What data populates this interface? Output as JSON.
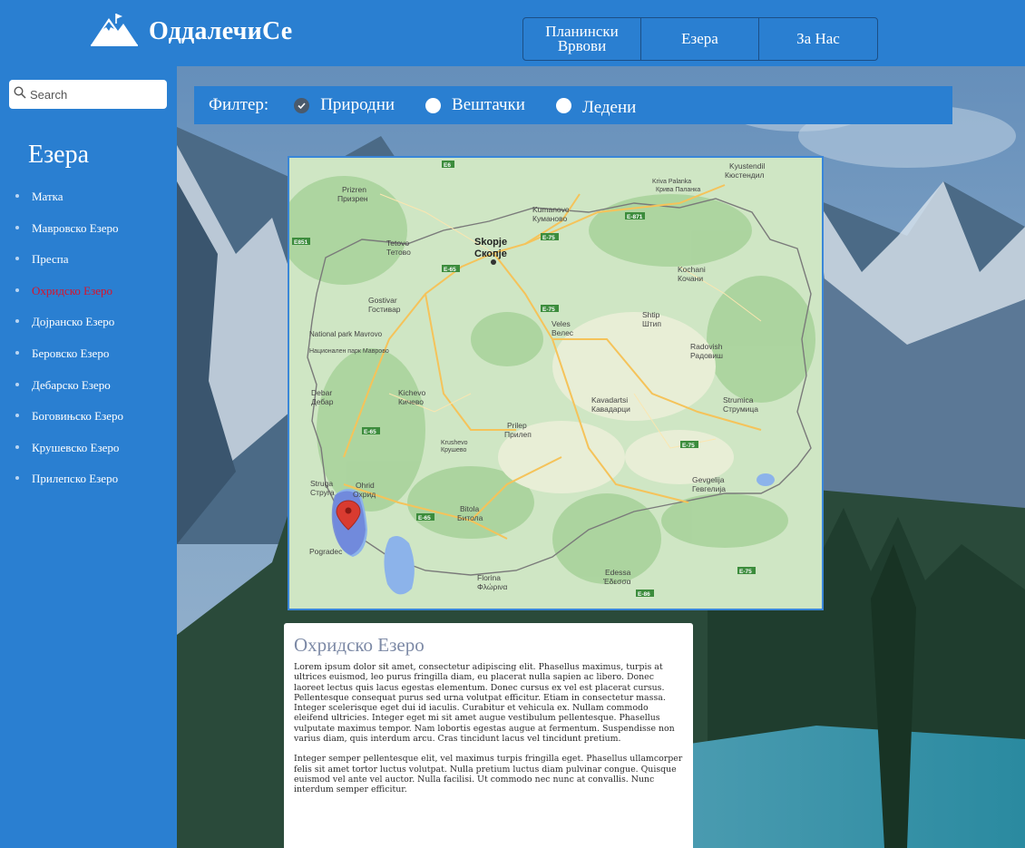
{
  "header": {
    "brand": "ОддалечиСе",
    "nav": [
      "Планински Врвови",
      "Езера",
      "За Нас"
    ]
  },
  "sidebar": {
    "search_placeholder": "Search",
    "heading": "Езера",
    "items": [
      {
        "label": "Матка",
        "active": false
      },
      {
        "label": "Мавровско Езеро",
        "active": false
      },
      {
        "label": "Преспа",
        "active": false
      },
      {
        "label": "Охридско Езеро",
        "active": true
      },
      {
        "label": "Дојранско Езеро",
        "active": false
      },
      {
        "label": "Беровско Езеро",
        "active": false
      },
      {
        "label": "Дебарско Езеро",
        "active": false
      },
      {
        "label": "Боговињско Езеро",
        "active": false
      },
      {
        "label": "Крушевско Езеро",
        "active": false
      },
      {
        "label": "Прилепско Езеро",
        "active": false
      }
    ]
  },
  "filter": {
    "label": "Филтер:",
    "options": [
      {
        "label": "Природни",
        "checked": true
      },
      {
        "label": "Вештачки",
        "checked": false
      },
      {
        "label": "Ледени",
        "checked": false
      }
    ]
  },
  "map": {
    "places": [
      {
        "name": "Skopje",
        "alt": "Скопје",
        "bold": true
      },
      {
        "name": "Kumanovo",
        "alt": "Куманово"
      },
      {
        "name": "Tetovo",
        "alt": "Тетово"
      },
      {
        "name": "Gostivar",
        "alt": "Гостивар"
      },
      {
        "name": "Kochani",
        "alt": "Кочани"
      },
      {
        "name": "Shtip",
        "alt": "Штип"
      },
      {
        "name": "Veles",
        "alt": "Велес"
      },
      {
        "name": "Radovish",
        "alt": "Радовиш"
      },
      {
        "name": "Kichevo",
        "alt": "Кичево"
      },
      {
        "name": "Debar",
        "alt": "Дебар"
      },
      {
        "name": "Kavadartsi",
        "alt": "Кавадарци"
      },
      {
        "name": "Strumica",
        "alt": "Струмица"
      },
      {
        "name": "Prilep",
        "alt": "Прилеп"
      },
      {
        "name": "Krushevo",
        "alt": "Крушево"
      },
      {
        "name": "Struga",
        "alt": "Струга"
      },
      {
        "name": "Ohrid",
        "alt": "Охрид"
      },
      {
        "name": "Bitola",
        "alt": "Битола"
      },
      {
        "name": "Gevgelija",
        "alt": "Гевгелија"
      },
      {
        "name": "Prizren",
        "alt": "Призрен"
      },
      {
        "name": "Kriva Palanka",
        "alt": "Крива Паланка"
      },
      {
        "name": "Kyustendil",
        "alt": "Кюстендил"
      },
      {
        "name": "Pogradec",
        "alt": ""
      },
      {
        "name": "Florina",
        "alt": "Φλώρινα"
      },
      {
        "name": "Edessa",
        "alt": "Έδεσσα"
      },
      {
        "name": "National park Mavrovo",
        "alt": "Национален парк Маврово"
      }
    ],
    "roads": [
      "E-65",
      "E-871",
      "E-75",
      "E-65",
      "E-65",
      "E-75",
      "E-75",
      "E-65",
      "E-86",
      "E851"
    ]
  },
  "article": {
    "title": "Охридско Езеро",
    "paragraphs": [
      "Lorem ipsum dolor sit amet, consectetur adipiscing elit. Phasellus maximus, turpis at ultrices euismod, leo purus fringilla diam, eu placerat nulla sapien ac libero. Donec laoreet lectus quis lacus egestas elementum. Donec cursus ex vel est placerat cursus. Pellentesque consequat purus sed urna volutpat efficitur. Etiam in consectetur massa. Integer scelerisque eget dui id iaculis. Curabitur et vehicula ex. Nullam commodo eleifend ultricies. Integer eget mi sit amet augue vestibulum pellentesque. Phasellus vulputate maximus tempor. Nam lobortis egestas augue at fermentum. Suspendisse non varius diam, quis interdum arcu. Cras tincidunt lacus vel tincidunt pretium.",
      "Integer semper pellentesque elit, vel maximus turpis fringilla eget. Phasellus ullamcorper felis sit amet tortor luctus volutpat. Nulla pretium luctus diam pulvinar congue. Quisque euismod vel ante vel auctor. Nulla facilisi. Ut commodo nec nunc at convallis. Nunc interdum semper efficitur."
    ]
  },
  "colors": {
    "primary": "#2a7fd1",
    "active_item": "#d8132c",
    "marker": "#d93b30"
  }
}
